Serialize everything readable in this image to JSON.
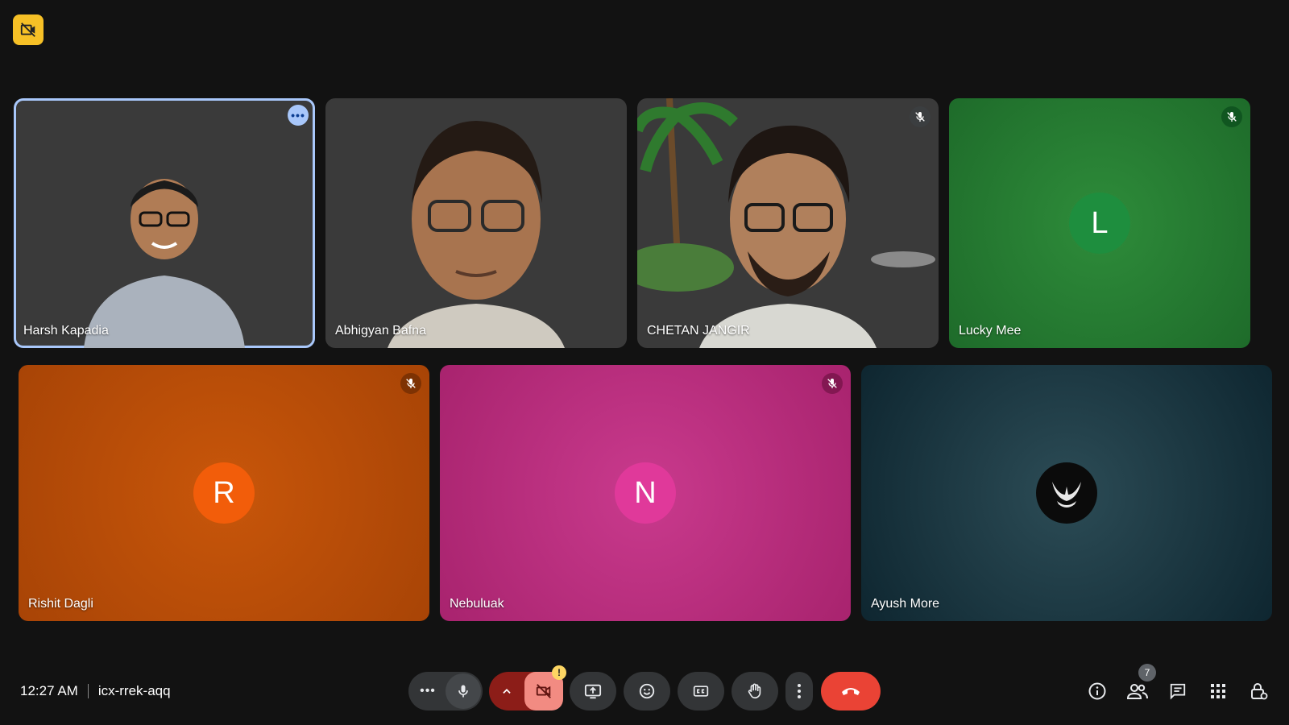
{
  "meeting": {
    "time": "12:27 AM",
    "code": "icx-rrek-aqq"
  },
  "participants": [
    {
      "name": "Harsh Kapadia"
    },
    {
      "name": "Abhigyan Bafna"
    },
    {
      "name": "CHETAN JANGIR"
    },
    {
      "name": "Lucky Mee",
      "initial": "L",
      "color": "#1e8e3e"
    },
    {
      "name": "Rishit Dagli",
      "initial": "R",
      "color": "#f25d0a"
    },
    {
      "name": "Nebuluak",
      "initial": "N",
      "color": "#e0399a"
    },
    {
      "name": "Ayush More"
    }
  ],
  "people_count": "7",
  "colors": {
    "background": "#121212",
    "recording_badge": "#f6c026",
    "leave_button": "#ea4335",
    "camera_off": "#f28b82",
    "active_outline": "#a8c7fa"
  },
  "icons": {
    "recording": "no-video-recording-icon",
    "microphone": "microphone-icon",
    "camera": "camera-off-icon",
    "present": "present-screen-icon",
    "emoji": "emoji-icon",
    "captions": "captions-icon",
    "raise_hand": "raise-hand-icon",
    "more": "more-vert-icon",
    "leave": "leave-call-icon",
    "info": "info-icon",
    "people": "people-icon",
    "chat": "chat-icon",
    "activities": "activities-icon",
    "host_controls": "host-controls-icon"
  }
}
